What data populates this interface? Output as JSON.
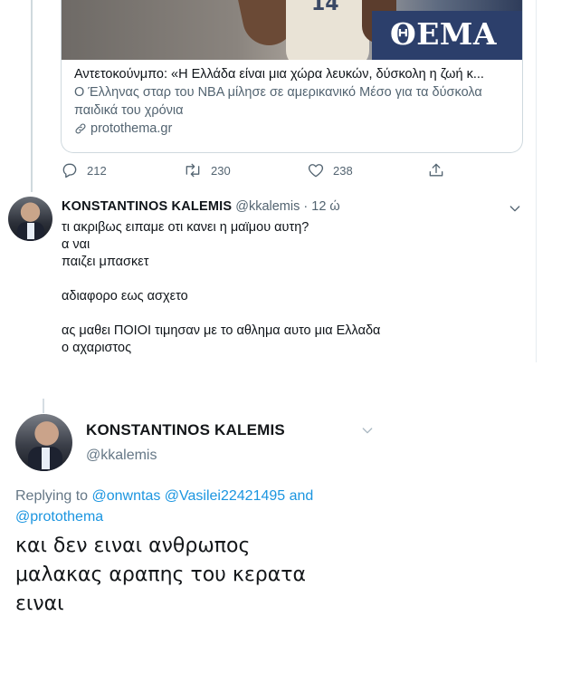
{
  "top": {
    "card": {
      "logo_text": "ΘΕΜΑ",
      "jersey_number": "14",
      "title": "Αντετοκούνμπο: «Η Ελλάδα είναι μια χώρα λευκών, δύσκολη η ζωή κ...",
      "description_line1": "Ο Έλληνας σταρ του NBA μίλησε σε αμερικανικό Μέσο για τα δύσκολα",
      "description_line2": "παιδικά του χρόνια",
      "link": "protothema.gr"
    },
    "actions": {
      "replies": "212",
      "retweets": "230",
      "likes": "238"
    },
    "reply_tweet": {
      "name": "KONSTANTINOS KALEMIS",
      "handle": "@kkalemis",
      "separator": "·",
      "time": "12 ώ",
      "lines": [
        "τι ακριβως ειπαμε οτι κανει η μαϊμου αυτη?",
        "α ναι",
        "παιζει μπασκετ",
        "",
        "αδιαφορο εως ασχετο",
        "",
        "ας μαθει ΠΟΙΟΙ τιμησαν με το αθλημα αυτο μια Ελλαδα",
        "ο αχαριστος"
      ]
    }
  },
  "bottom": {
    "name": "KONSTANTINOS KALEMIS",
    "handle": "@kkalemis",
    "replying_prefix": "Replying to ",
    "mention1": "@onwntas",
    "mention2": "@Vasilei22421495",
    "and_word": " and",
    "mention3": "@protothema",
    "body_lines": [
      "και δεν ειναι ανθρωπος",
      "μαλακας αραπης του κερατα",
      "ειναι"
    ]
  },
  "colors": {
    "link_blue": "#1b95e0",
    "secondary_gray": "#536471",
    "logo_navy": "#2c3f6b"
  },
  "icons": [
    "reply-icon",
    "retweet-icon",
    "like-icon",
    "share-icon",
    "link-icon",
    "chevron-down-icon"
  ]
}
